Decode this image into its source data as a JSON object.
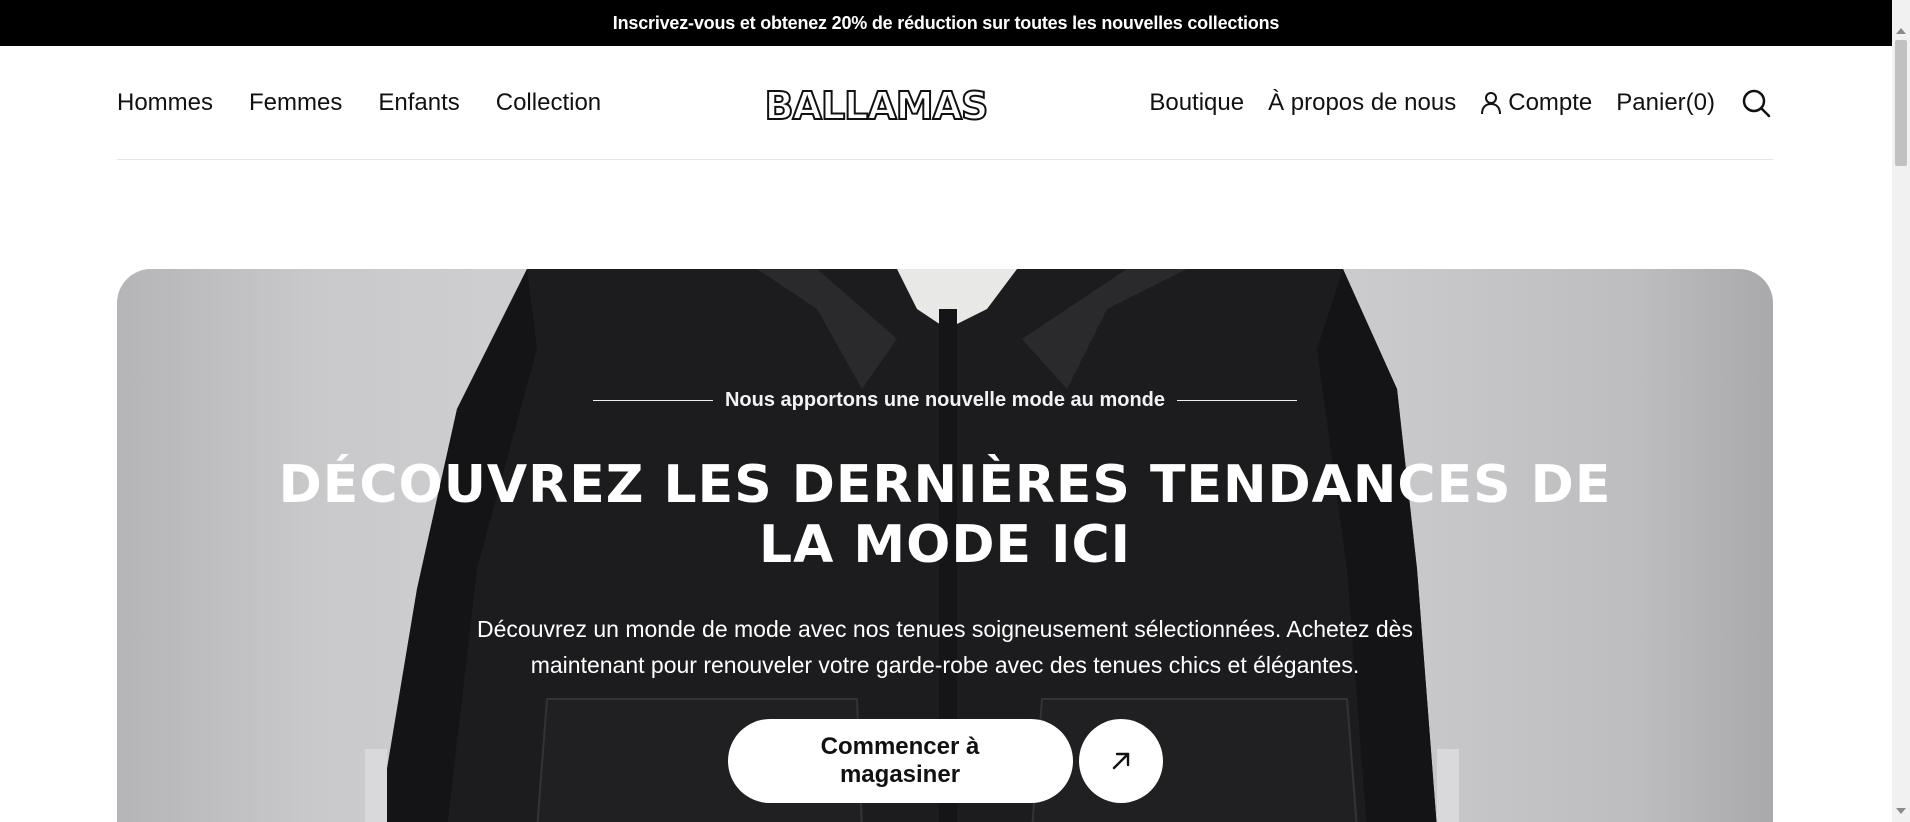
{
  "announcement": "Inscrivez-vous et obtenez 20% de réduction sur toutes les nouvelles collections",
  "nav": {
    "left": [
      "Hommes",
      "Femmes",
      "Enfants",
      "Collection"
    ],
    "logo": "BALLAMAS",
    "boutique": "Boutique",
    "about": "À propos de nous",
    "account": "Compte",
    "cart": "Panier(0)"
  },
  "hero": {
    "tagline": "Nous apportons une nouvelle mode au monde",
    "title": "DÉCOUVREZ LES DERNIÈRES TENDANCES DE LA MODE ICI",
    "description": "Découvrez un monde de mode avec nos tenues soigneusement sélectionnées. Achetez dès maintenant pour renouveler votre garde-robe avec des tenues chics et élégantes.",
    "cta": "Commencer à magasiner"
  },
  "icons": {
    "account": "user-icon",
    "search": "search-icon",
    "cta_arrow": "arrow-up-right-icon"
  },
  "colors": {
    "announcement_bg": "#000000",
    "hero_jacket": "#1c1c1e"
  }
}
